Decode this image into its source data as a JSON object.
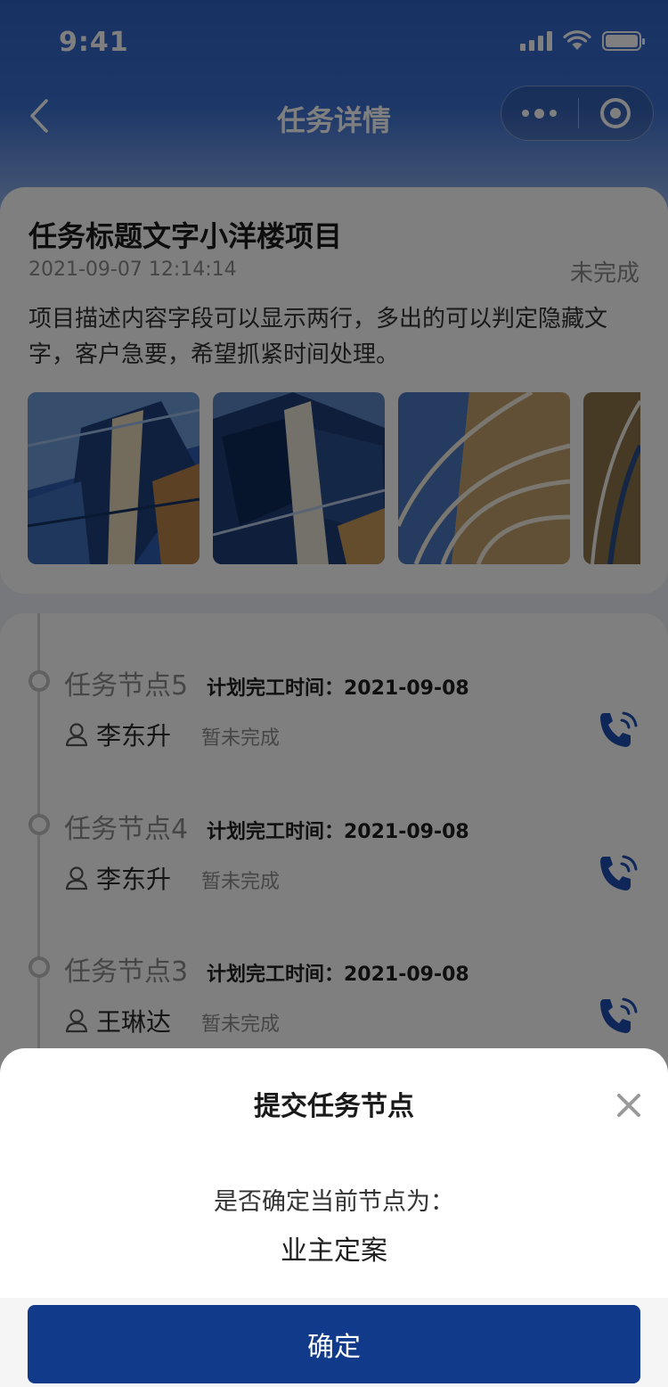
{
  "status_bar": {
    "time": "9:41"
  },
  "nav": {
    "title": "任务详情"
  },
  "task": {
    "title": "任务标题文字小洋楼项目",
    "datetime": "2021-09-07 12:14:14",
    "status": "未完成",
    "description": "项目描述内容字段可以显示两行，多出的可以判定隐藏文字，客户急要，希望抓紧时间处理。"
  },
  "timeline": {
    "nodes": [
      {
        "name": "任务节点5",
        "plan_label": "计划完工时间：2021-09-08",
        "assignee": "李东升",
        "state": "暂未完成"
      },
      {
        "name": "任务节点4",
        "plan_label": "计划完工时间：2021-09-08",
        "assignee": "李东升",
        "state": "暂未完成"
      },
      {
        "name": "任务节点3",
        "plan_label": "计划完工时间：2021-09-08",
        "assignee": "王琳达",
        "state": "暂未完成"
      }
    ]
  },
  "dialog": {
    "title": "提交任务节点",
    "question": "是否确定当前节点为：",
    "node_name": "业主定案",
    "confirm_label": "确定"
  },
  "icons": {
    "back": "chevron-left-icon",
    "more": "more-dots-icon",
    "close_miniprogram": "target-icon",
    "person": "user-icon",
    "phone": "phone-call-icon",
    "close": "close-icon"
  },
  "colors": {
    "header_blue": "#2f63c8",
    "primary_button": "#123a8a",
    "phone_icon": "#1f4fb0"
  }
}
